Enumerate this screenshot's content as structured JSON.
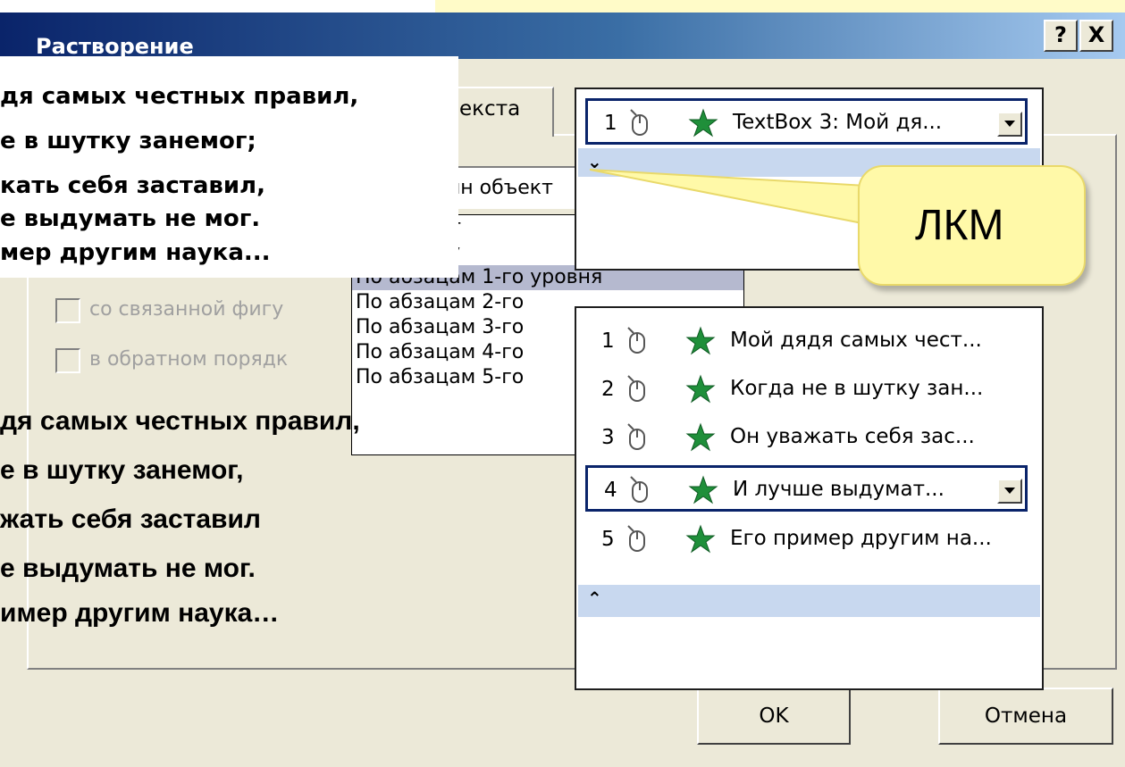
{
  "dialog": {
    "title": "Растворение",
    "help_label": "?",
    "close_label": "X",
    "tab_label": "екста"
  },
  "combo": {
    "value": "ин объект"
  },
  "listbox": {
    "items": [
      "ин объект",
      "ацы сразу",
      "По абзацам 1-го уровня",
      "По абзацам 2-го",
      "По абзацам 3-го",
      "По абзацам 4-го",
      "По абзацам 5-го"
    ]
  },
  "options": {
    "linked_shape": "со связанной фигу",
    "reverse_order": "в обратном порядк"
  },
  "poem_top": [
    "дя самых честных правил,",
    "е в шутку занемог;",
    "кать себя заставил,",
    "е выдумать не мог.",
    "мер другим наука..."
  ],
  "poem_bottom": [
    "дя самых честных правил,",
    "е в шутку занемог,",
    "жать себя заставил",
    "е выдумать не мог.",
    "имер другим наука…"
  ],
  "animation_pane_top": {
    "item": {
      "num": "1",
      "text": "TextBox 3: Мой дя..."
    }
  },
  "animation_pane_bottom": {
    "items": [
      {
        "num": "1",
        "text": "Мой дядя самых чест..."
      },
      {
        "num": "2",
        "text": "Когда не в шутку зан..."
      },
      {
        "num": "3",
        "text": "Он уважать себя зас..."
      },
      {
        "num": "4",
        "text": "И лучше выдумат..."
      },
      {
        "num": "5",
        "text": "Его пример другим на..."
      }
    ]
  },
  "callout": {
    "text": "ЛКМ"
  },
  "buttons": {
    "ok": "OK",
    "cancel": "Отмена"
  },
  "colors": {
    "titlebar": "#0a246a",
    "dialog_bg": "#ece9d8",
    "callout_fill": "#fff9a8",
    "star_green": "#1f8f3a",
    "chevron_bar": "#c8d8ef"
  }
}
